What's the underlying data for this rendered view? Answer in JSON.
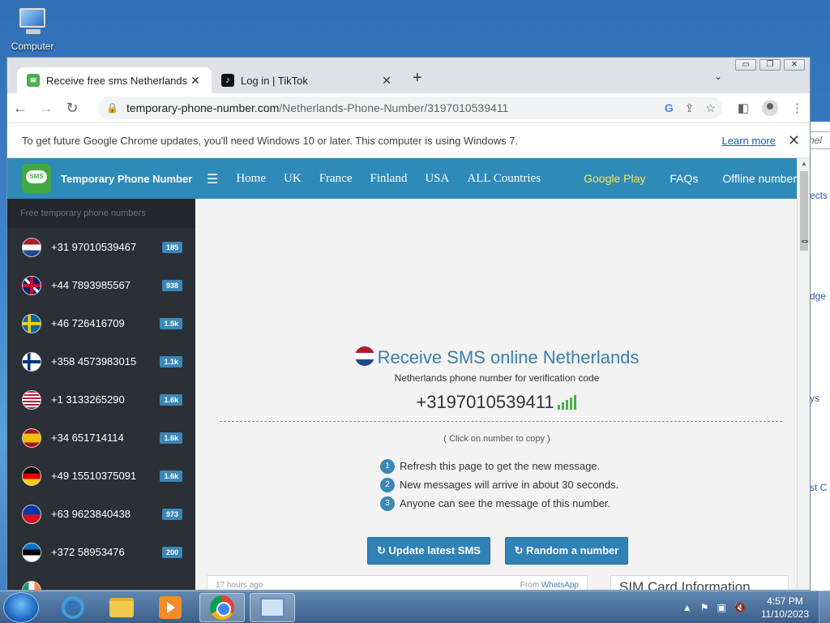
{
  "desktop": {
    "icon_label": "Computer"
  },
  "bg_window": {
    "field_text": "nel",
    "frag1": "ects",
    "frag2": "dge",
    "frag3": "ys",
    "frag4": "st C"
  },
  "browser": {
    "tabs": [
      {
        "title": "Receive free sms Netherlands mobile number",
        "icon": "sms-favicon"
      },
      {
        "title": "Log in | TikTok",
        "icon": "tiktok-favicon"
      }
    ],
    "url_host": "temporary-phone-number.com",
    "url_path": "/Netherlands-Phone-Number/3197010539411",
    "infobar_text": "To get future Google Chrome updates, you'll need Windows 10 or later. This computer is using Windows 7.",
    "infobar_link": "Learn more"
  },
  "site": {
    "brand": "Temporary Phone Number",
    "logo_text": "SMS",
    "sidebar_heading": "Free temporary phone numbers",
    "numbers": [
      {
        "number": "+31 97010539467",
        "count": "185",
        "flag": "nl"
      },
      {
        "number": "+44 7893985567",
        "count": "938",
        "flag": "uk"
      },
      {
        "number": "+46 726416709",
        "count": "1.5k",
        "flag": "se"
      },
      {
        "number": "+358 4573983015",
        "count": "1.1k",
        "flag": "fi"
      },
      {
        "number": "+1 3133265290",
        "count": "1.6k",
        "flag": "us"
      },
      {
        "number": "+34 651714114",
        "count": "1.6k",
        "flag": "es"
      },
      {
        "number": "+49 15510375091",
        "count": "1.6k",
        "flag": "de"
      },
      {
        "number": "+63 9623840438",
        "count": "973",
        "flag": "ph"
      },
      {
        "number": "+372 58953476",
        "count": "200",
        "flag": "ee"
      }
    ],
    "nav": [
      "Home",
      "UK",
      "France",
      "Finland",
      "USA",
      "ALL Countries"
    ],
    "nav_right": [
      "Google Play",
      "FAQs",
      "Offline number"
    ],
    "title": "Receive SMS online Netherlands",
    "subtitle": "Netherlands phone number for verification code",
    "phone": "+3197010539411",
    "copy_hint": "( Click on number to copy )",
    "steps": [
      "Refresh this page to get the new message.",
      "New messages will arrive in about 30 seconds.",
      "Anyone can see the message of this number."
    ],
    "btn_update": "↻ Update latest SMS",
    "btn_random": "↻ Random a number",
    "msg_time": "17 hours ago",
    "msg_from_label": "From",
    "msg_from": "WhatsApp",
    "sim_heading": "SIM Card Information"
  },
  "taskbar": {
    "time": "4:57 PM",
    "date": "11/10/2023"
  }
}
